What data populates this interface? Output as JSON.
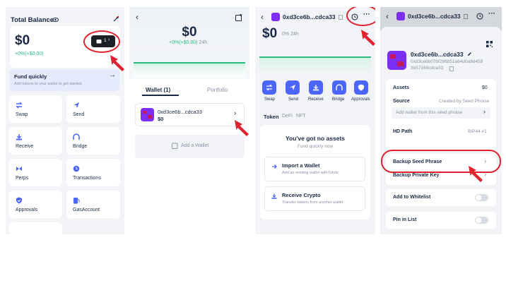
{
  "colors": {
    "accent": "#4c65ff",
    "accent_bg": "#e6eaff",
    "green": "#2abb7f",
    "annotation_red": "#e0242f",
    "avatar_purple": "#7b2ff7",
    "text_dark": "#192945",
    "text_muted": "#8a94a6"
  },
  "home": {
    "title": "Total Balance",
    "balance": "$0",
    "change": "+0%(+$0.00)",
    "wallet_badge_count": "1",
    "fund_title": "Fund quickly",
    "fund_subtitle": "Add tokens to your wallet to get started.",
    "actions": [
      {
        "label": "Swap",
        "icon": "swap-icon"
      },
      {
        "label": "Send",
        "icon": "send-icon"
      },
      {
        "label": "Receive",
        "icon": "receive-icon"
      },
      {
        "label": "Bridge",
        "icon": "bridge-icon"
      },
      {
        "label": "Perps",
        "icon": "perps-icon"
      },
      {
        "label": "Transactions",
        "icon": "clock-icon"
      },
      {
        "label": "Approvals",
        "icon": "shield-icon"
      },
      {
        "label": "GasAccount",
        "icon": "gas-icon"
      }
    ]
  },
  "wallets": {
    "balance": "$0",
    "change": "+0%(+$0.00)",
    "period": "24h",
    "tab_wallet": "Wallet (1)",
    "tab_portfolio": "Portfolio",
    "wallet_name": "0xd3ce6b...cdca33",
    "wallet_balance": "$0",
    "add_wallet": "Add a Wallet"
  },
  "account": {
    "address_short": "0xd3ce6b...cdca33",
    "balance": "$0",
    "change": "0%",
    "period": "24h",
    "actions": [
      "Swap",
      "Send",
      "Receive",
      "Bridge",
      "Approvals"
    ],
    "tabs": [
      "Token",
      "DeFi",
      "NFT"
    ],
    "empty_title": "You've got no assets",
    "empty_subtitle": "Fund quickly now",
    "import_title": "Import a Wallet",
    "import_subtitle": "Add an existing wallet with funds",
    "receive_title": "Receive Crypto",
    "receive_subtitle": "Transfer tokens from another wallet"
  },
  "details": {
    "header_address": "0xd3ce6b...cdca33",
    "name": "0xd3ce6b...cdca33",
    "full_address_line1": "0xd3ce6b07bf286b51a64d0a9d459",
    "full_address_line2": "3b57169cdca33",
    "assets_label": "Assets",
    "assets_value": "$0",
    "source_label": "Source",
    "source_value": "Created by Seed Phrase",
    "add_wallet_seed": "Add wallet from this seed phrase",
    "hd_path_label": "HD Path",
    "hd_path_value": "BIP44 #1",
    "backup_seed": "Backup Seed Phrase",
    "backup_private": "Backup Private Key",
    "whitelist": "Add to Whitelist",
    "pin": "Pin in List"
  }
}
